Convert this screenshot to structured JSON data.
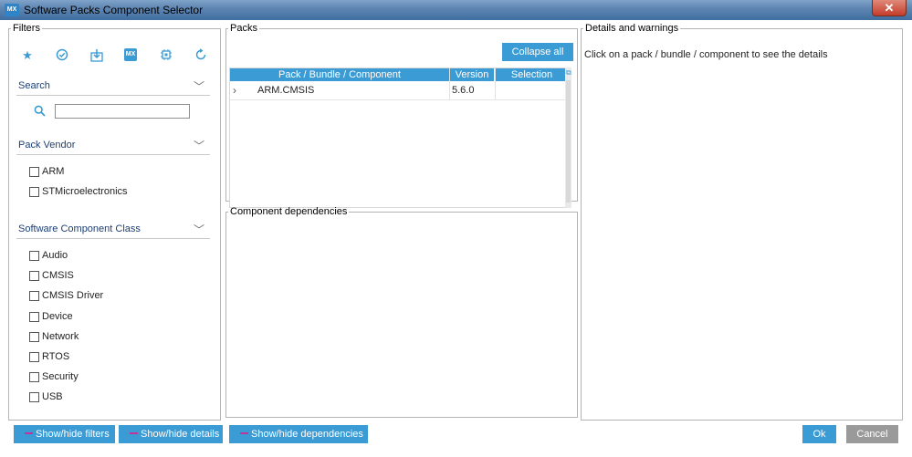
{
  "window": {
    "title": "Software Packs Component Selector",
    "app_icon": "MX",
    "close_glyph": "✕"
  },
  "filters": {
    "legend": "Filters",
    "icons": [
      "star-icon",
      "check-circle-icon",
      "download-icon",
      "mx-icon",
      "chip-icon",
      "refresh-icon"
    ],
    "mx_icon_text": "MX",
    "search": {
      "header": "Search",
      "placeholder": "",
      "value": ""
    },
    "pack_vendor": {
      "header": "Pack Vendor",
      "items": [
        "ARM",
        "STMicroelectronics"
      ]
    },
    "component_class": {
      "header": "Software Component Class",
      "items": [
        "Audio",
        "CMSIS",
        "CMSIS Driver",
        "Device",
        "Network",
        "RTOS",
        "Security",
        "USB"
      ]
    }
  },
  "packs": {
    "legend": "Packs",
    "collapse_label": "Collapse all",
    "columns": [
      "Pack / Bundle / Component",
      "Version",
      "Selection"
    ],
    "rows": [
      {
        "name": "ARM.CMSIS",
        "version": "5.6.0",
        "selection": ""
      }
    ]
  },
  "dependencies": {
    "legend": "Component dependencies"
  },
  "details": {
    "legend": "Details and warnings",
    "text": "Click on a pack / bundle / component to see the details"
  },
  "footer": {
    "show_hide_filters": "Show/hide filters",
    "show_hide_details": "Show/hide details",
    "show_hide_dependencies": "Show/hide dependencies",
    "ok": "Ok",
    "cancel": "Cancel"
  },
  "colors": {
    "accent": "#3a9bd5",
    "marker": "#c0359c",
    "disabled_button": "#9a9a9a"
  }
}
